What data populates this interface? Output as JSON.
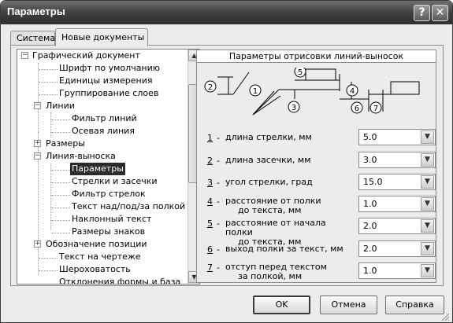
{
  "window": {
    "title": "Параметры",
    "help_glyph": "?",
    "close_glyph": "✕"
  },
  "tabs": [
    {
      "label": "Система",
      "active": false
    },
    {
      "label": "Новые документы",
      "active": true
    }
  ],
  "tree": {
    "items": [
      {
        "label": "Графический документ",
        "expander": "−"
      },
      {
        "label": "Шрифт по умолчанию"
      },
      {
        "label": "Единицы измерения"
      },
      {
        "label": "Группирование слоев"
      },
      {
        "label": "Линии",
        "expander": "−"
      },
      {
        "label": "Фильтр линий"
      },
      {
        "label": "Осевая линия"
      },
      {
        "label": "Размеры",
        "expander": "+"
      },
      {
        "label": "Линия-выноска",
        "expander": "−"
      },
      {
        "label": "Параметры",
        "selected": true
      },
      {
        "label": "Стрелки и засечки"
      },
      {
        "label": "Фильтр стрелок"
      },
      {
        "label": "Текст над/под/за полкой"
      },
      {
        "label": "Наклонный текст"
      },
      {
        "label": "Размеры знаков"
      },
      {
        "label": "Обозначение позиции",
        "expander": "+"
      },
      {
        "label": "Текст на чертеже"
      },
      {
        "label": "Шероховатость"
      },
      {
        "label": "Отклонения формы и база"
      }
    ],
    "scroll_up_glyph": "▲",
    "scroll_down_glyph": "▼"
  },
  "params": {
    "header": "Параметры отрисовки линий-выносок",
    "diagram_labels": [
      "1",
      "2",
      "3",
      "4",
      "5",
      "6",
      "7"
    ],
    "rows": [
      {
        "num": "1",
        "dash": "-",
        "line1": "длина стрелки, мм",
        "line2": "",
        "value": "5.0"
      },
      {
        "num": "2",
        "dash": "-",
        "line1": "длина засечки, мм",
        "line2": "",
        "value": "3.0"
      },
      {
        "num": "3",
        "dash": "-",
        "line1": "угол стрелки, град",
        "line2": "",
        "value": "15.0"
      },
      {
        "num": "4",
        "dash": "-",
        "line1": "расстояние от полки",
        "line2": "до текста, мм",
        "value": "1.0"
      },
      {
        "num": "5",
        "dash": "-",
        "line1": "расстояние от начала полки",
        "line2": "до текста, мм",
        "value": "2.0"
      },
      {
        "num": "6",
        "dash": "-",
        "line1": "выход полки за текст, мм",
        "line2": "",
        "value": "2.0"
      },
      {
        "num": "7",
        "dash": "-",
        "line1": "отступ перед текстом",
        "line2": "за полкой, мм",
        "value": "1.0"
      }
    ],
    "combo_arrow_glyph": "▼"
  },
  "buttons": {
    "ok": "OK",
    "cancel": "Отмена",
    "help": "Справка"
  }
}
